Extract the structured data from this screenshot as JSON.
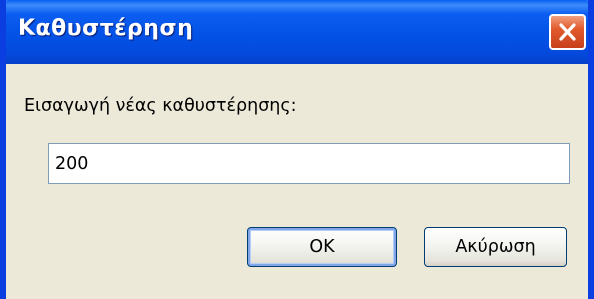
{
  "dialog": {
    "title": "Καθυστέρηση",
    "prompt": "Εισαγωγή νέας καθυστέρησης:",
    "input_value": "200",
    "ok_label": "OK",
    "cancel_label": "Ακύρωση"
  },
  "icons": {
    "close": "close-icon"
  },
  "colors": {
    "titlebar": "#0452e6",
    "frame": "#0a3ee0",
    "body": "#ece9d8",
    "close_button": "#e25a2c",
    "default_button_focus": "#7fa6e8"
  }
}
